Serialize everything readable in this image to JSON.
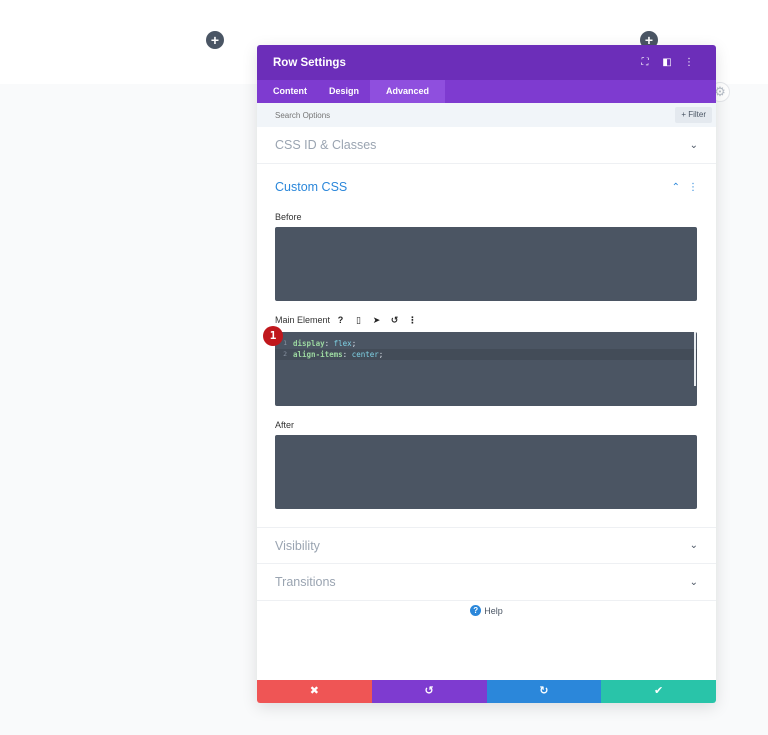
{
  "header": {
    "title": "Row Settings",
    "icons": [
      "focus-icon",
      "sidebar-icon",
      "more-icon"
    ]
  },
  "tabs": [
    {
      "label": "Content",
      "active": false
    },
    {
      "label": "Design",
      "active": false
    },
    {
      "label": "Advanced",
      "active": true
    }
  ],
  "search": {
    "placeholder": "Search Options"
  },
  "filter": {
    "label": "Filter"
  },
  "sections": {
    "css_id": "CSS ID & Classes",
    "custom_css": "Custom CSS",
    "visibility": "Visibility",
    "transitions": "Transitions"
  },
  "custom_css": {
    "before_label": "Before",
    "main_label": "Main Element",
    "after_label": "After",
    "code": [
      {
        "line": "1",
        "prop": "display",
        "value": "flex"
      },
      {
        "line": "2",
        "prop": "align-items",
        "value": "center"
      }
    ]
  },
  "badge": "1",
  "help": "Help",
  "footer": {
    "cancel_color": "#ef5555",
    "undo_color": "#7e3bd0",
    "redo_color": "#2b87da",
    "save_color": "#29c4a9"
  },
  "colors": {
    "header": "#6c2eb9",
    "tabs": "#7e3bd0",
    "accent": "#2b87da"
  }
}
